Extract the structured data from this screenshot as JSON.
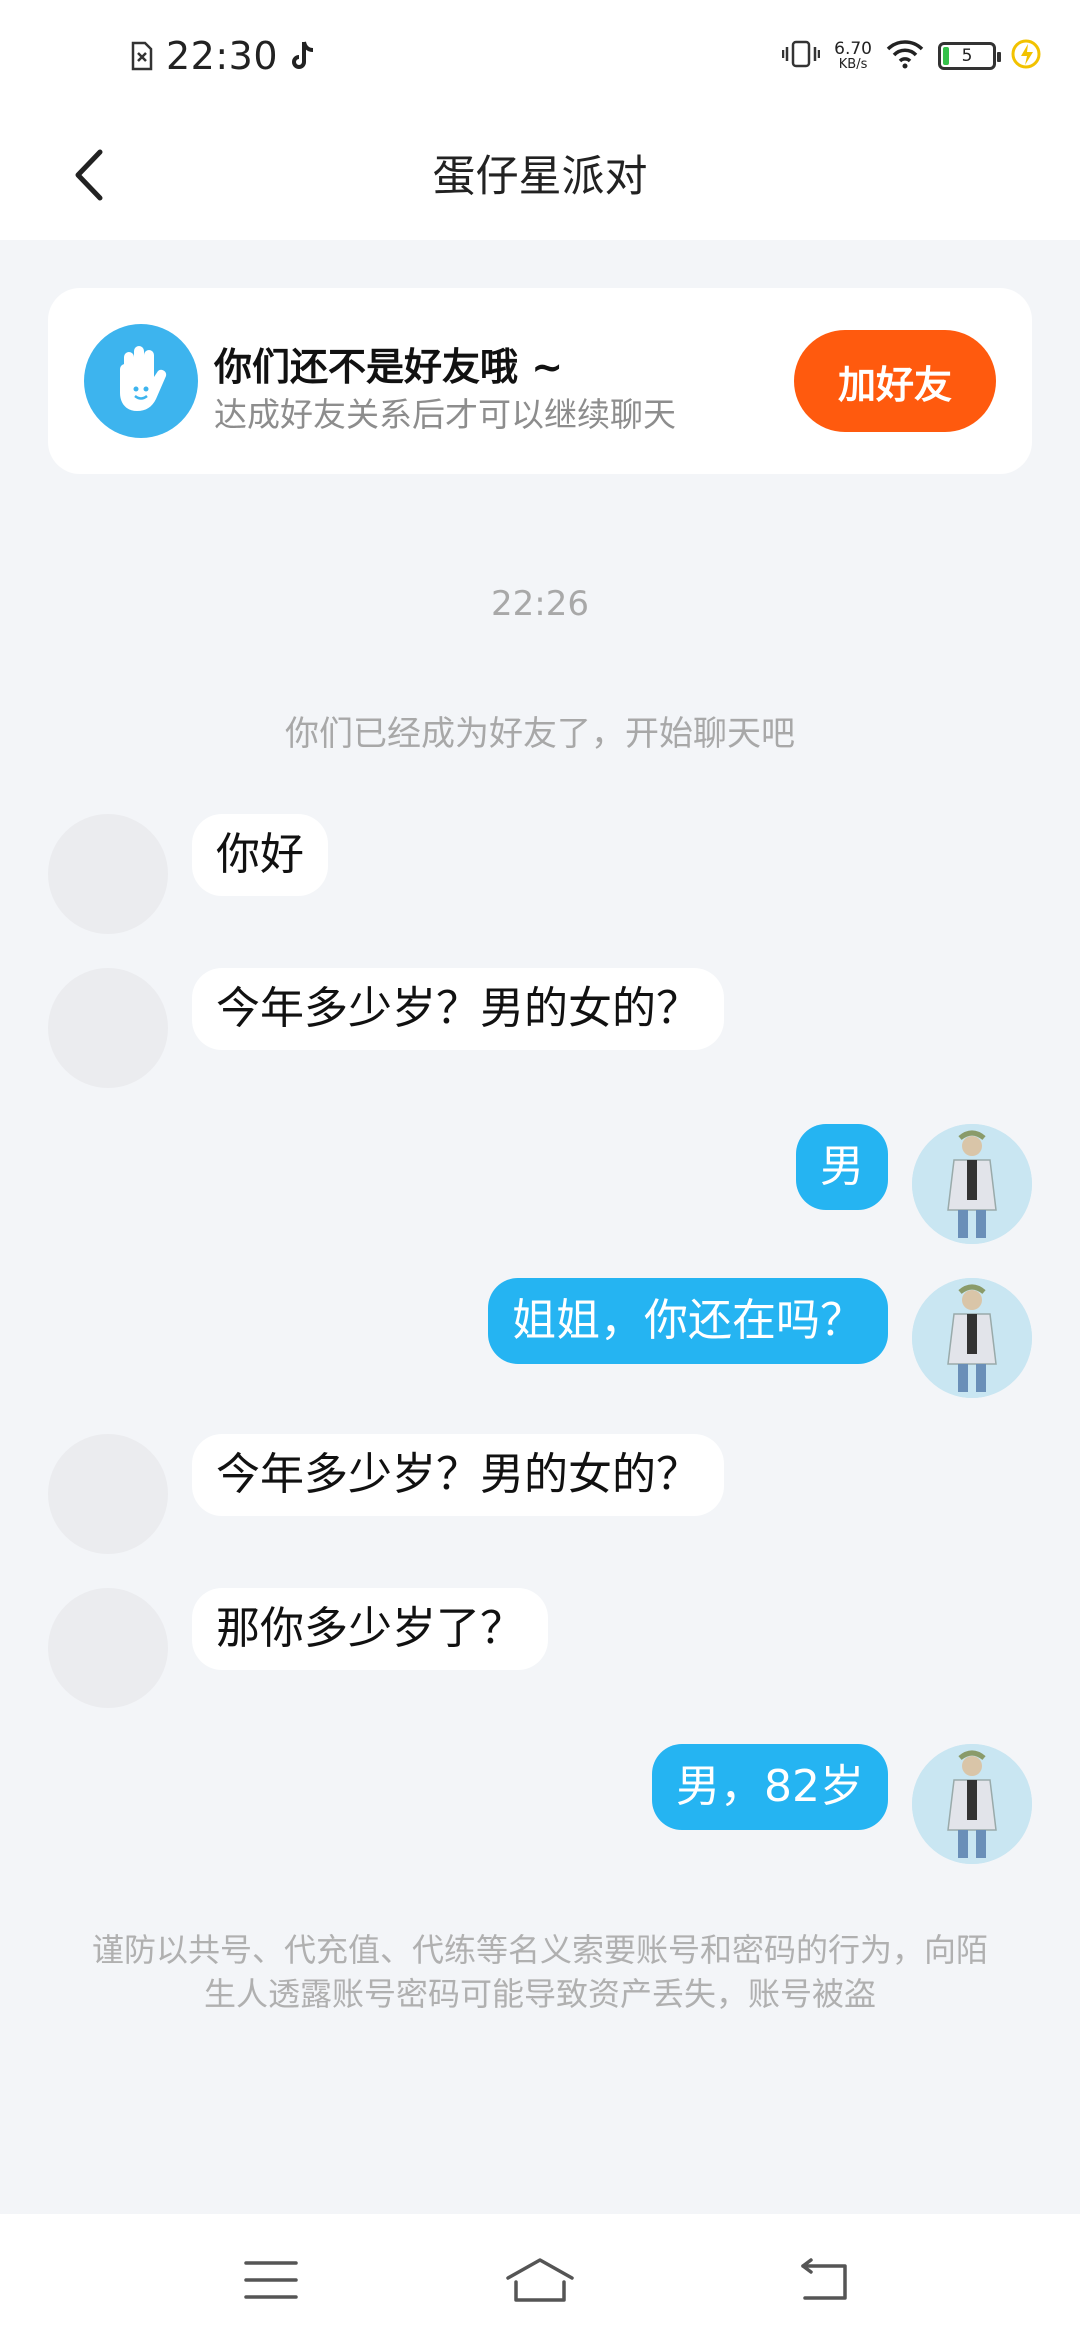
{
  "status_bar": {
    "time": "22:30",
    "net_speed_value": "6.70",
    "net_speed_unit": "KB/s",
    "battery_level": "5",
    "battery_color": "#35c14a",
    "icons": [
      "sim-alert-icon",
      "tiktok-icon",
      "vibrate-icon",
      "wifi-icon",
      "battery-icon",
      "charging-icon"
    ]
  },
  "header": {
    "title": "蛋仔星派对",
    "back_icon": "chevron-left-icon"
  },
  "friend_banner": {
    "title": "你们还不是好友哦 ~",
    "subtitle": "达成好友关系后才可以继续聊天",
    "button_label": "加好友",
    "button_color": "#ff5a0e",
    "avatar_icon": "waving-hand-icon"
  },
  "chat": {
    "timestamp": "22:26",
    "system_message": "你们已经成为好友了，开始聊天吧",
    "messages": [
      {
        "side": "left",
        "text": "你好"
      },
      {
        "side": "left",
        "text": "今年多少岁？男的女的？"
      },
      {
        "side": "right",
        "text": "男"
      },
      {
        "side": "right",
        "text": "姐姐，你还在吗？"
      },
      {
        "side": "left",
        "text": "今年多少岁？男的女的？"
      },
      {
        "side": "left",
        "text": "那你多少岁了？"
      },
      {
        "side": "right",
        "text": "男，82岁"
      }
    ],
    "warning": "谨防以共号、代充值、代练等名义索要账号和密码的行为，向陌生人透露账号密码可能导致资产丢失，账号被盗"
  },
  "nav_bar": {
    "icons": [
      "menu-icon",
      "home-icon",
      "back-icon"
    ]
  },
  "colors": {
    "bubble_mine": "#25b4f2",
    "background": "#f3f5f8"
  }
}
